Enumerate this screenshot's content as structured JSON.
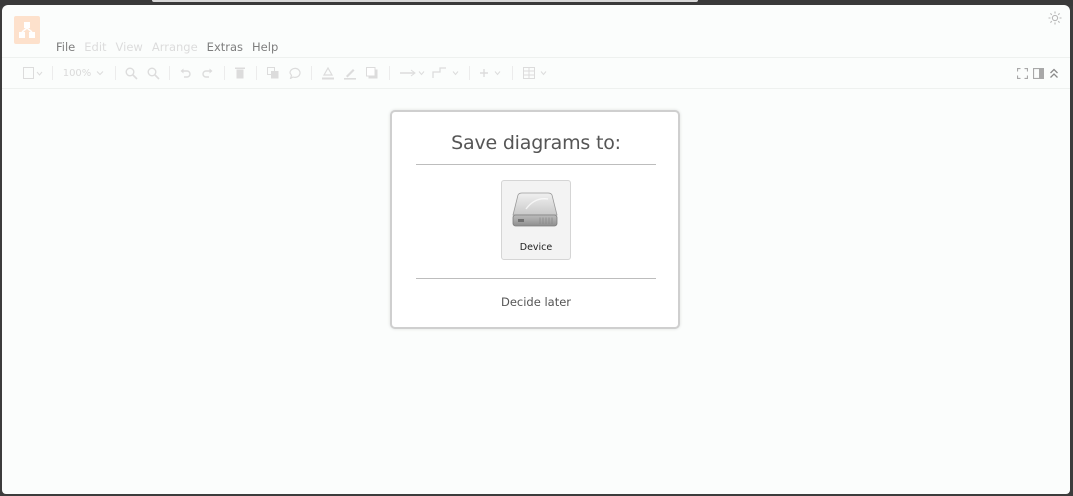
{
  "menu": {
    "items": [
      {
        "label": "File",
        "enabled": true
      },
      {
        "label": "Edit",
        "enabled": false
      },
      {
        "label": "View",
        "enabled": false
      },
      {
        "label": "Arrange",
        "enabled": false
      },
      {
        "label": "Extras",
        "enabled": true
      },
      {
        "label": "Help",
        "enabled": true
      }
    ]
  },
  "toolbar": {
    "zoom_label": "100%",
    "icons": [
      "page-view-icon",
      "zoom-in-icon",
      "zoom-out-icon",
      "undo-icon",
      "redo-icon",
      "delete-icon",
      "to-front-icon",
      "to-back-icon",
      "fill-color-icon",
      "line-color-icon",
      "shadow-icon",
      "connection-icon",
      "waypoints-icon",
      "insert-icon",
      "table-icon",
      "fullscreen-icon",
      "format-panel-icon",
      "collapse-icon"
    ]
  },
  "dialog": {
    "title": "Save diagrams to:",
    "options": [
      {
        "label": "Device",
        "icon": "hard-drive-icon"
      }
    ],
    "decide_later": "Decide later"
  },
  "colors": {
    "window_bg": "#fbfdfc",
    "logo": "#fde1cc",
    "dialog_border": "#cfcfcf"
  }
}
